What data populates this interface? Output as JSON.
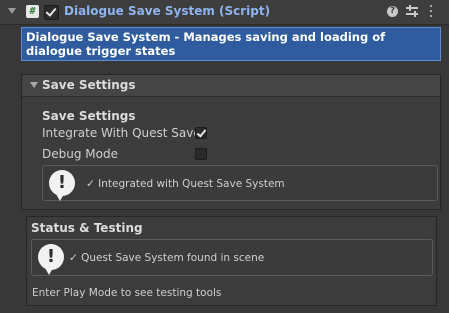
{
  "component": {
    "title": "Dialogue Save System (Script)",
    "script_icon_glyph": "#",
    "enabled": true
  },
  "description": "Dialogue Save System - Manages saving and loading of dialogue trigger states",
  "save_settings_foldout": {
    "label": "Save Settings",
    "section_header": "Save Settings",
    "fields": [
      {
        "label": "Integrate With Quest Save",
        "checked": true
      },
      {
        "label": "Debug Mode",
        "checked": false
      }
    ],
    "info_message": "✓ Integrated with Quest Save System"
  },
  "status_testing": {
    "title": "Status & Testing",
    "info_message": "✓ Quest Save System found in scene",
    "footer": "Enter Play Mode to see testing tools"
  },
  "icons": {
    "help": "?",
    "info": "!"
  },
  "colors": {
    "title_blue": "#8fb4f0",
    "banner_blue": "#2f5c9e"
  }
}
